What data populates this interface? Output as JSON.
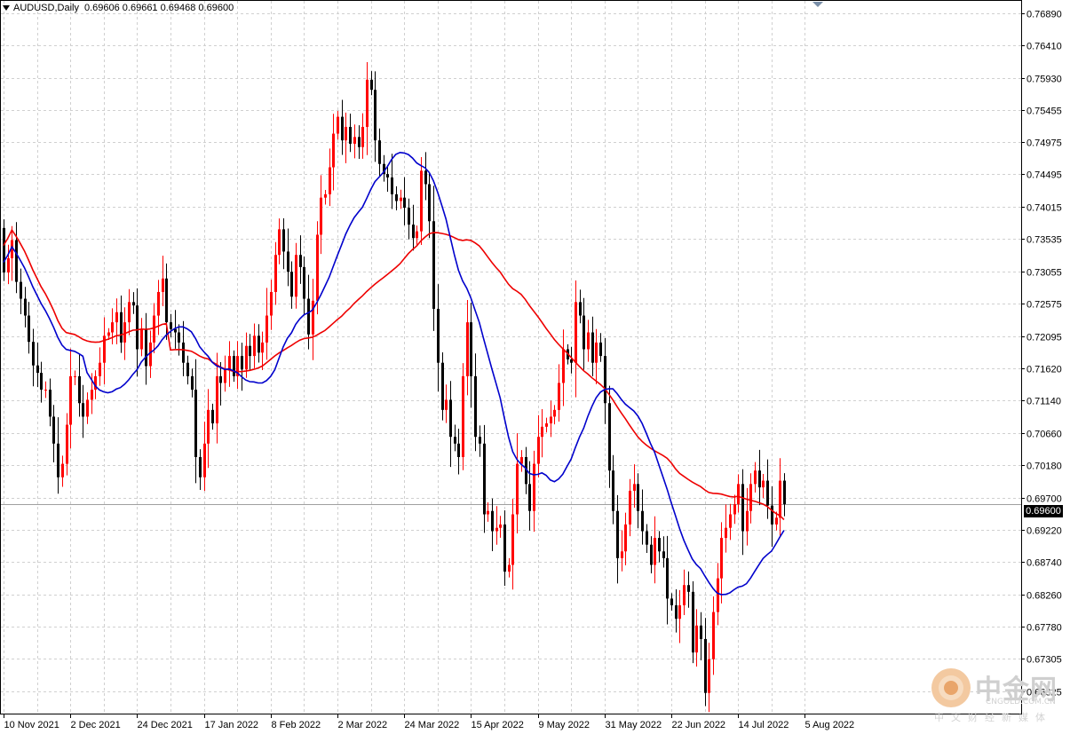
{
  "header": {
    "symbol": "AUDUSD,Daily",
    "ohlc": "0.69606 0.69661 0.69468 0.69600"
  },
  "current_price_label": "0.69600",
  "watermark": {
    "name": "中金网",
    "url": "CNGOLD.COM.CN",
    "subtitle": "中文财经新媒体"
  },
  "colors": {
    "bull": "#ff0000",
    "bear": "#000000",
    "ma_fast": "#0000cc",
    "ma_slow": "#ee0000",
    "grid": "#d0d0d0",
    "price_line": "#a0a0a0"
  },
  "chart_data": {
    "type": "candlestick",
    "title": "AUDUSD,Daily",
    "ylim": [
      0.6648,
      0.7707
    ],
    "y_ticks": [
      "0.76890",
      "0.76410",
      "0.75930",
      "0.75455",
      "0.74975",
      "0.74495",
      "0.74015",
      "0.73535",
      "0.73055",
      "0.72575",
      "0.72095",
      "0.71620",
      "0.71140",
      "0.70660",
      "0.70180",
      "0.69700",
      "0.69220",
      "0.68740",
      "0.68260",
      "0.67780",
      "0.67305",
      "0.66825"
    ],
    "x_tick_labels": [
      "10 Nov 2021",
      "2 Dec 2021",
      "24 Dec 2021",
      "17 Jan 2022",
      "8 Feb 2022",
      "2 Mar 2022",
      "24 Mar 2022",
      "15 Apr 2022",
      "9 May 2022",
      "31 May 2022",
      "22 Jun 2022",
      "14 Jul 2022",
      "5 Aug 2022"
    ],
    "x_tick_bar_index": [
      0,
      16,
      32,
      48,
      64,
      80,
      96,
      112,
      128,
      144,
      160,
      176,
      192
    ],
    "grid": true,
    "current_price": 0.696,
    "close": [
      0.7304,
      0.7325,
      0.7352,
      0.729,
      0.7265,
      0.724,
      0.7201,
      0.7166,
      0.7155,
      0.713,
      0.713,
      0.709,
      0.705,
      0.7,
      0.702,
      0.7078,
      0.715,
      0.715,
      0.711,
      0.709,
      0.7115,
      0.713,
      0.715,
      0.717,
      0.721,
      0.7215,
      0.723,
      0.7245,
      0.72,
      0.723,
      0.726,
      0.7255,
      0.719,
      0.722,
      0.7165,
      0.72,
      0.724,
      0.7275,
      0.7295,
      0.723,
      0.722,
      0.7215,
      0.72,
      0.717,
      0.715,
      0.713,
      0.703,
      0.7,
      0.705,
      0.71,
      0.708,
      0.715,
      0.714,
      0.716,
      0.718,
      0.715,
      0.718,
      0.716,
      0.7195,
      0.718,
      0.721,
      0.7185,
      0.72,
      0.724,
      0.7275,
      0.733,
      0.7368,
      0.7335,
      0.7305,
      0.7268,
      0.733,
      0.7312,
      0.7265,
      0.7212,
      0.7262,
      0.736,
      0.7415,
      0.742,
      0.746,
      0.751,
      0.7535,
      0.75,
      0.752,
      0.7495,
      0.7505,
      0.749,
      0.752,
      0.759,
      0.7575,
      0.75,
      0.7465,
      0.745,
      0.7445,
      0.742,
      0.741,
      0.7415,
      0.74,
      0.7375,
      0.7355,
      0.7365,
      0.7455,
      0.7435,
      0.738,
      0.725,
      0.717,
      0.71,
      0.7115,
      0.706,
      0.705,
      0.703,
      0.715,
      0.723,
      0.715,
      0.706,
      0.705,
      0.6945,
      0.695,
      0.692,
      0.6925,
      0.693,
      0.686,
      0.687,
      0.6945,
      0.702,
      0.703,
      0.699,
      0.695,
      0.702,
      0.706,
      0.7075,
      0.708,
      0.709,
      0.71,
      0.714,
      0.719,
      0.7175,
      0.717,
      0.726,
      0.724,
      0.719,
      0.7215,
      0.717,
      0.72,
      0.718,
      0.711,
      0.701,
      0.695,
      0.688,
      0.689,
      0.693,
      0.698,
      0.699,
      0.695,
      0.692,
      0.69,
      0.687,
      0.691,
      0.689,
      0.688,
      0.682,
      0.681,
      0.679,
      0.681,
      0.684,
      0.683,
      0.674,
      0.678,
      0.676,
      0.668,
      0.673,
      0.68,
      0.685,
      0.691,
      0.6925,
      0.6945,
      0.696,
      0.699,
      0.692,
      0.695,
      0.699,
      0.701,
      0.6985,
      0.6995,
      0.6958,
      0.693,
      0.694,
      0.6995,
      0.696
    ]
  }
}
